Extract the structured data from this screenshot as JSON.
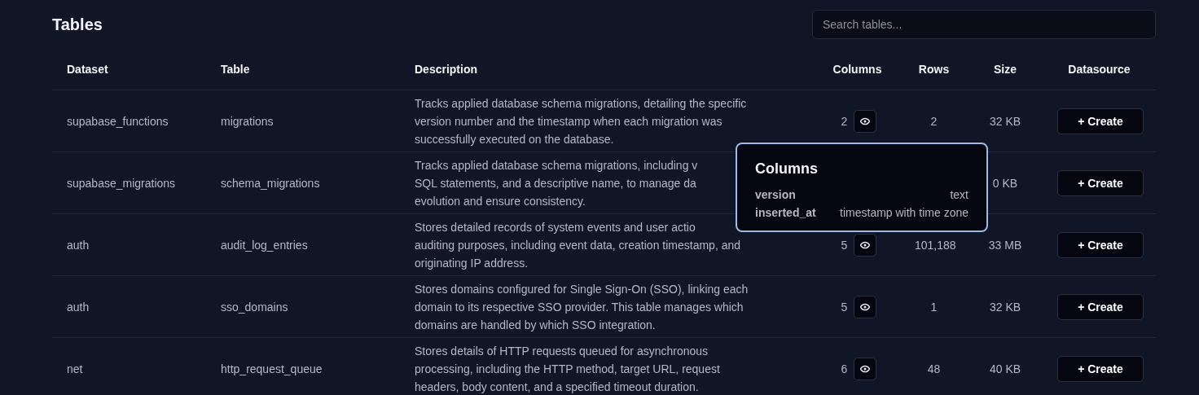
{
  "title": "Tables",
  "search": {
    "placeholder": "Search tables..."
  },
  "table": {
    "columns": [
      "Dataset",
      "Table",
      "Description",
      "Columns",
      "Rows",
      "Size",
      "Datasource"
    ],
    "rows": [
      {
        "dataset": "supabase_functions",
        "table": "migrations",
        "description_lines": [
          "Tracks applied database schema migrations, detailing the specific",
          "version number and the timestamp when each migration was",
          "successfully executed on the database."
        ],
        "columns": "2",
        "rows": "2",
        "size": "32 KB",
        "action": "+ Create"
      },
      {
        "dataset": "supabase_migrations",
        "table": "schema_migrations",
        "description_lines": [
          "Tracks applied database schema migrations, including v",
          "SQL statements, and a descriptive name, to manage da",
          "evolution and ensure consistency."
        ],
        "size": "0 KB",
        "action": "+ Create"
      },
      {
        "dataset": "auth",
        "table": "audit_log_entries",
        "description_lines": [
          "Stores detailed records of system events and user actio",
          "auditing purposes, including event data, creation timestamp, and",
          "originating IP address."
        ],
        "columns": "5",
        "rows": "101,188",
        "size": "33 MB",
        "action": "+ Create"
      },
      {
        "dataset": "auth",
        "table": "sso_domains",
        "description_lines": [
          "Stores domains configured for Single Sign-On (SSO), linking each",
          "domain to its respective SSO provider. This table manages which",
          "domains are handled by which SSO integration."
        ],
        "columns": "5",
        "rows": "1",
        "size": "32 KB",
        "action": "+ Create"
      },
      {
        "dataset": "net",
        "table": "http_request_queue",
        "description_lines": [
          "Stores details of HTTP requests queued for asynchronous",
          "processing, including the HTTP method, target URL, request",
          "headers, body content, and a specified timeout duration."
        ],
        "columns": "6",
        "rows": "48",
        "size": "40 KB",
        "action": "+ Create"
      }
    ]
  },
  "tooltip": {
    "title": "Columns",
    "items": [
      {
        "name": "version",
        "type": "text"
      },
      {
        "name": "inserted_at",
        "type": "timestamp with time zone"
      }
    ]
  }
}
